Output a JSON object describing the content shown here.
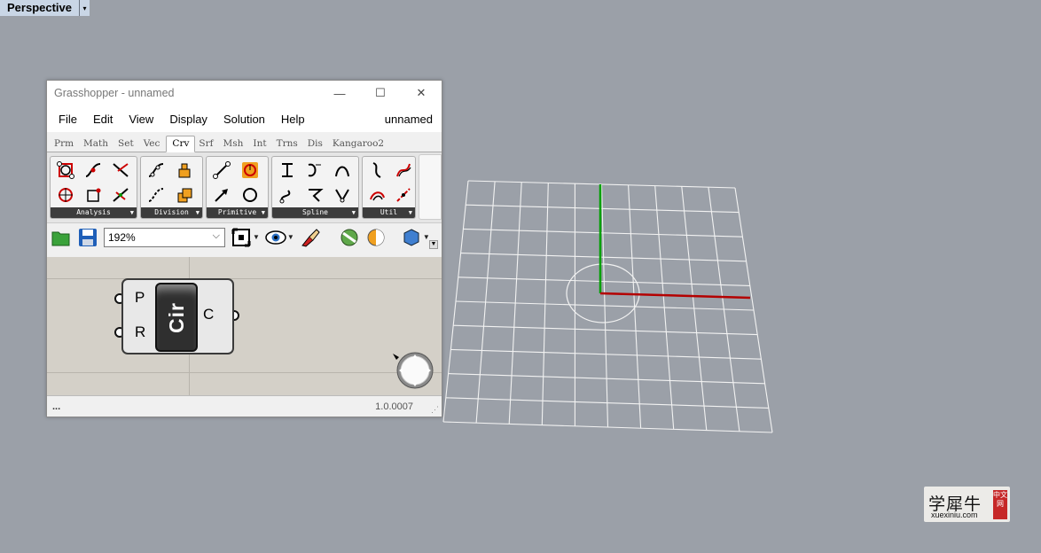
{
  "viewport": {
    "label": "Perspective",
    "dropdown": "▾"
  },
  "grasshopper": {
    "title": "Grasshopper - unnamed",
    "window_buttons": [
      "—",
      "☐",
      "✕"
    ],
    "menu": [
      "File",
      "Edit",
      "View",
      "Display",
      "Solution",
      "Help"
    ],
    "document_name": "unnamed",
    "tabs": [
      "Prm",
      "Math",
      "Set",
      "Vec",
      "Crv",
      "Srf",
      "Msh",
      "Int",
      "Trns",
      "Dis",
      "Kangaroo2"
    ],
    "active_tab": "Crv",
    "panels": [
      {
        "label": "Analysis",
        "icons": [
          "curve-analysis-icon",
          "evaluate-curve-icon",
          "curve-closest-point-icon",
          "polygon-center-icon",
          "curve-intersect-icon",
          "curve-side-icon"
        ]
      },
      {
        "label": "Division",
        "icons": [
          "divide-curve-icon",
          "dash-pattern-icon",
          "contour-icon",
          "shatter-icon"
        ]
      },
      {
        "label": "Primitive",
        "icons": [
          "line-icon",
          "vector-line-icon",
          "arc-icon",
          "circle-icon"
        ]
      },
      {
        "label": "Spline",
        "icons": [
          "interpolate-icon",
          "polyline-icon",
          "nurbs-curve-icon",
          "bezier-span-icon",
          "kinky-curve-icon",
          "tangent-curve-icon"
        ]
      },
      {
        "label": "Util",
        "icons": [
          "offset-curve-icon",
          "fillet-icon",
          "join-curves-icon",
          "explode-icon"
        ]
      }
    ],
    "toolbar": {
      "zoom_value": "192%"
    },
    "component": {
      "nickname": "Cir",
      "inputs": [
        "P",
        "R"
      ],
      "outputs": [
        "C"
      ]
    },
    "status": {
      "left": "...",
      "version": "1.0.0007"
    }
  },
  "watermark": {
    "main": "学犀牛",
    "sub": "xuexiniu.com",
    "badge": "中文网"
  },
  "colors": {
    "viewport_bg": "#9ba0a8",
    "x_axis": "#b40000",
    "y_axis": "#00a000",
    "canvas_bg": "#d4d0c8"
  }
}
